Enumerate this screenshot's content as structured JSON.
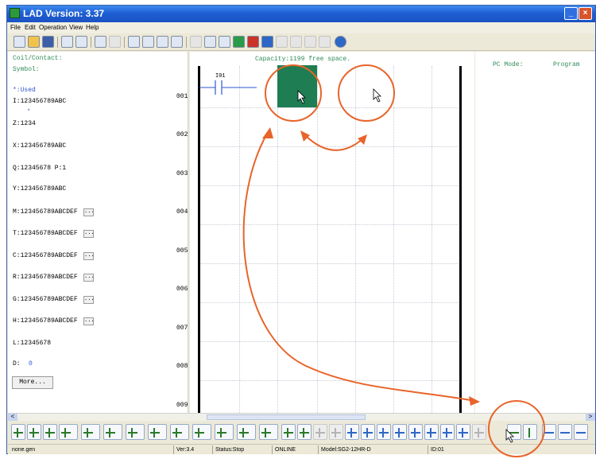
{
  "window": {
    "title": "LAD Version: 3.37",
    "minimize_label": "_",
    "close_label": "×"
  },
  "menu": {
    "items": [
      "File",
      "Edit",
      "Operation",
      "View",
      "Help"
    ]
  },
  "toolbar": {
    "icons": [
      "new-icon",
      "open-icon",
      "save-icon",
      "print-setup-icon",
      "preview-icon",
      "undo-icon",
      "redo-icon",
      "monitor-icon",
      "ladder-icon",
      "function-block-icon",
      "hmi-icon",
      "settings-icon",
      "write-icon",
      "read-icon",
      "run-icon",
      "stop-icon",
      "online-icon",
      "sim-icon",
      "dim-icon",
      "dim-icon",
      "dim-icon",
      "help-icon"
    ]
  },
  "left_panel": {
    "coil_contact_label": "Coil/Contact:",
    "symbol_label": "Symbol:",
    "used_label": "*:Used",
    "rows": [
      "I:123456789ABC",
      "Z:1234",
      "X:123456789ABC",
      "Q:12345678 P:1",
      "Y:123456789ABC",
      "M:123456789ABCDEF",
      "T:123456789ABCDEF",
      "C:123456789ABCDEF",
      "R:123456789ABCDEF",
      "G:123456789ABCDEF",
      "H:123456789ABCDEF",
      "L:12345678"
    ],
    "i_marker": "*",
    "d_label": "D:",
    "d_value": "0",
    "ellipsis_label": "...",
    "more_button": "More..."
  },
  "ladder": {
    "capacity_text": "Capacity:1199 free space.",
    "contact_label": "I01",
    "rung_numbers": [
      "001",
      "002",
      "003",
      "004",
      "005",
      "006",
      "007",
      "008",
      "009"
    ]
  },
  "right_panel": {
    "pc_mode_label": "PC Mode:",
    "pc_mode_value": "Program"
  },
  "hscroll": {
    "left_arrow": "<",
    "right_arrow": ">"
  },
  "status_bar": {
    "file": "none.gen",
    "version": "Ver:3.4",
    "status": "Status:Stop",
    "connection": "ONLINE",
    "model": "Model:SG2-12HR-D",
    "id": "ID:01"
  },
  "annotation": {
    "color": "#e8642a"
  }
}
